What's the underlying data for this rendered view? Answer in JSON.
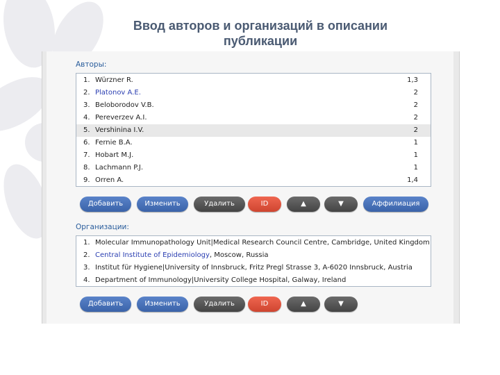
{
  "slide": {
    "title_line1": "Ввод авторов и организаций в описании",
    "title_line2": "публикации"
  },
  "authors": {
    "label": "Авторы:",
    "selected_index": 4,
    "items": [
      {
        "num": "1.",
        "name": "Würzner R.",
        "aff": "1,3"
      },
      {
        "num": "2.",
        "name": "Platonov A.E.",
        "aff": "2"
      },
      {
        "num": "3.",
        "name": "Beloborodov V.B.",
        "aff": "2"
      },
      {
        "num": "4.",
        "name": "Pereverzev A.I.",
        "aff": "2"
      },
      {
        "num": "5.",
        "name": "Vershinina I.V.",
        "aff": "2"
      },
      {
        "num": "6.",
        "name": "Fernie B.A.",
        "aff": "1"
      },
      {
        "num": "7.",
        "name": "Hobart M.J.",
        "aff": "1"
      },
      {
        "num": "8.",
        "name": "Lachmann P.J.",
        "aff": "1"
      },
      {
        "num": "9.",
        "name": "Orren A.",
        "aff": "1,4"
      }
    ],
    "buttons": {
      "add": "Добавить",
      "edit": "Изменить",
      "delete": "Удалить",
      "id": "ID",
      "up": "▲",
      "down": "▼",
      "affiliation": "Аффилиация"
    }
  },
  "organizations": {
    "label": "Организации:",
    "items": [
      {
        "num": "1.",
        "name": "Molecular Immunopathology Unit|Medical Research Council Centre, Cambridge, United Kingdom",
        "highlight": "",
        "rest": ""
      },
      {
        "num": "2.",
        "name": "",
        "highlight": "Central Institute of Epidemiology",
        "rest": ", Moscow, Russia"
      },
      {
        "num": "3.",
        "name": "Institut für Hygiene|University of Innsbruck, Fritz Pregl Strasse 3, A-6020 Innsbruck, Austria",
        "highlight": "",
        "rest": ""
      },
      {
        "num": "4.",
        "name": "Department of Immunology|University College Hospital, Galway, Ireland",
        "highlight": "",
        "rest": ""
      }
    ],
    "buttons": {
      "add": "Добавить",
      "edit": "Изменить",
      "delete": "Удалить",
      "id": "ID",
      "up": "▲",
      "down": "▼"
    }
  },
  "colors": {
    "blue_button": "#4a73b9",
    "dark_button": "#555555",
    "red_button": "#df5540",
    "label_blue": "#2a5d9c",
    "link_blue": "#2a3eb1"
  }
}
